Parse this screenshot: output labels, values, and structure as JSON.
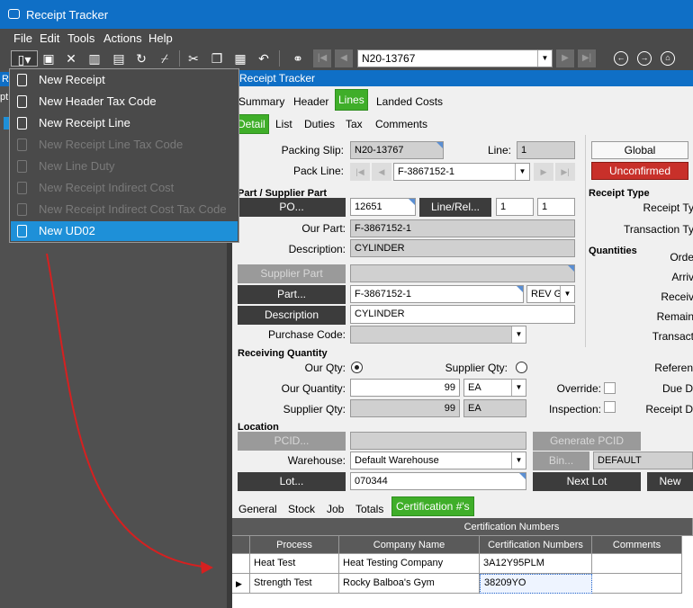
{
  "app": {
    "title": "Receipt Tracker"
  },
  "menu": [
    "File",
    "Edit",
    "Tools",
    "Actions",
    "Help"
  ],
  "toolbar": {
    "record_id": "N20-13767"
  },
  "left_panel": {
    "fragments": [
      "R",
      "pt",
      ""
    ]
  },
  "new_menu": {
    "items": [
      {
        "label": "New Receipt",
        "enabled": true
      },
      {
        "label": "New Header Tax Code",
        "enabled": true
      },
      {
        "label": "New Receipt Line",
        "enabled": true
      },
      {
        "label": "New Receipt Line Tax Code",
        "enabled": false
      },
      {
        "label": "New Line Duty",
        "enabled": false
      },
      {
        "label": "New Receipt Indirect Cost",
        "enabled": false
      },
      {
        "label": "New Receipt Indirect Cost Tax Code",
        "enabled": false
      },
      {
        "label": "New UD02",
        "enabled": true,
        "selected": true
      }
    ]
  },
  "panel_title": "Receipt Tracker",
  "tabs_main": [
    "Summary",
    "Header",
    "Lines",
    "Landed Costs"
  ],
  "tabs_main_active": "Lines",
  "tabs_sub": [
    "Detail",
    "List",
    "Duties",
    "Tax",
    "Comments"
  ],
  "tabs_sub_active": "Detail",
  "form": {
    "packing_slip_label": "Packing Slip:",
    "packing_slip": "N20-13767",
    "line_label": "Line:",
    "line": "1",
    "global_button": "Global",
    "status_button": "Unconfirmed",
    "pack_line_label": "Pack Line:",
    "pack_line": "F-3867152-1",
    "part_supplier_section": "Part / Supplier Part",
    "po_button": "PO...",
    "po_num": "12651",
    "line_rel_button": "Line/Rel...",
    "line_num": "1",
    "rel_num": "1",
    "our_part_label": "Our Part:",
    "our_part": "F-3867152-1",
    "description_label": "Description:",
    "description": "CYLINDER",
    "supplier_part_button": "Supplier Part",
    "supplier_part": "",
    "part_button": "Part...",
    "part": "F-3867152-1",
    "rev": "REV G",
    "description_button": "Description",
    "description2": "CYLINDER",
    "purchase_code_label": "Purchase Code:",
    "purchase_code": "",
    "receiving_qty_section": "Receiving Quantity",
    "our_qty_radio": "Our Qty:",
    "supplier_qty_radio": "Supplier Qty:",
    "our_quantity_label": "Our Quantity:",
    "our_quantity": "99",
    "our_uom": "EA",
    "override_label": "Override:",
    "supplier_qty_label": "Supplier Qty:",
    "supplier_qty": "99",
    "supplier_uom": "EA",
    "inspection_label": "Inspection:",
    "location_section": "Location",
    "pcid_button": "PCID...",
    "pcid": "",
    "generate_pcid_button": "Generate PCID",
    "warehouse_label": "Warehouse:",
    "warehouse": "Default Warehouse",
    "bin_button": "Bin...",
    "bin": "DEFAULT",
    "lot_button": "Lot...",
    "lot": "070344",
    "next_lot_button": "Next Lot",
    "new_button": "New"
  },
  "right_col": {
    "receipt_type_section": "Receipt Type",
    "receipt_type_label": "Receipt Ty",
    "transaction_type_label": "Transaction Ty",
    "quantities_section": "Quantities",
    "labels": [
      "Orde",
      "Arriv",
      "Receiv",
      "Remain",
      "Transact"
    ],
    "reference_label": "Referen",
    "due_label": "Due D",
    "receipt_date_label": "Receipt D"
  },
  "tabs_bottom": [
    "General",
    "Stock",
    "Job",
    "Totals",
    "Certification #'s"
  ],
  "tabs_bottom_active": "Certification #'s",
  "grid": {
    "group_header": "Certification Numbers",
    "columns": [
      "Process",
      "Company Name",
      "Certification Numbers",
      "Comments"
    ],
    "rows": [
      {
        "process": "Heat Test",
        "company": "Heat Testing Company",
        "cert": "3A12Y95PLM",
        "comments": ""
      },
      {
        "process": "Strength Test",
        "company": "Rocky Balboa's Gym",
        "cert": "38209YO",
        "comments": ""
      }
    ]
  },
  "colors": {
    "title_bar": "#0f6fc6",
    "active_tab": "#3fae29",
    "unconfirmed": "#c8302a",
    "menu_selected": "#1e90d8",
    "arrow": "#d62020"
  },
  "icons": [
    "new-doc-icon",
    "save-icon",
    "delete-icon",
    "book-icon",
    "paste-icon",
    "refresh-icon",
    "broom-icon",
    "cut-icon",
    "copy-icon",
    "clipboard-icon",
    "undo-icon",
    "binoculars-icon",
    "first-icon",
    "prev-icon",
    "next-icon",
    "last-icon",
    "back-icon",
    "forward-icon",
    "home-icon"
  ]
}
